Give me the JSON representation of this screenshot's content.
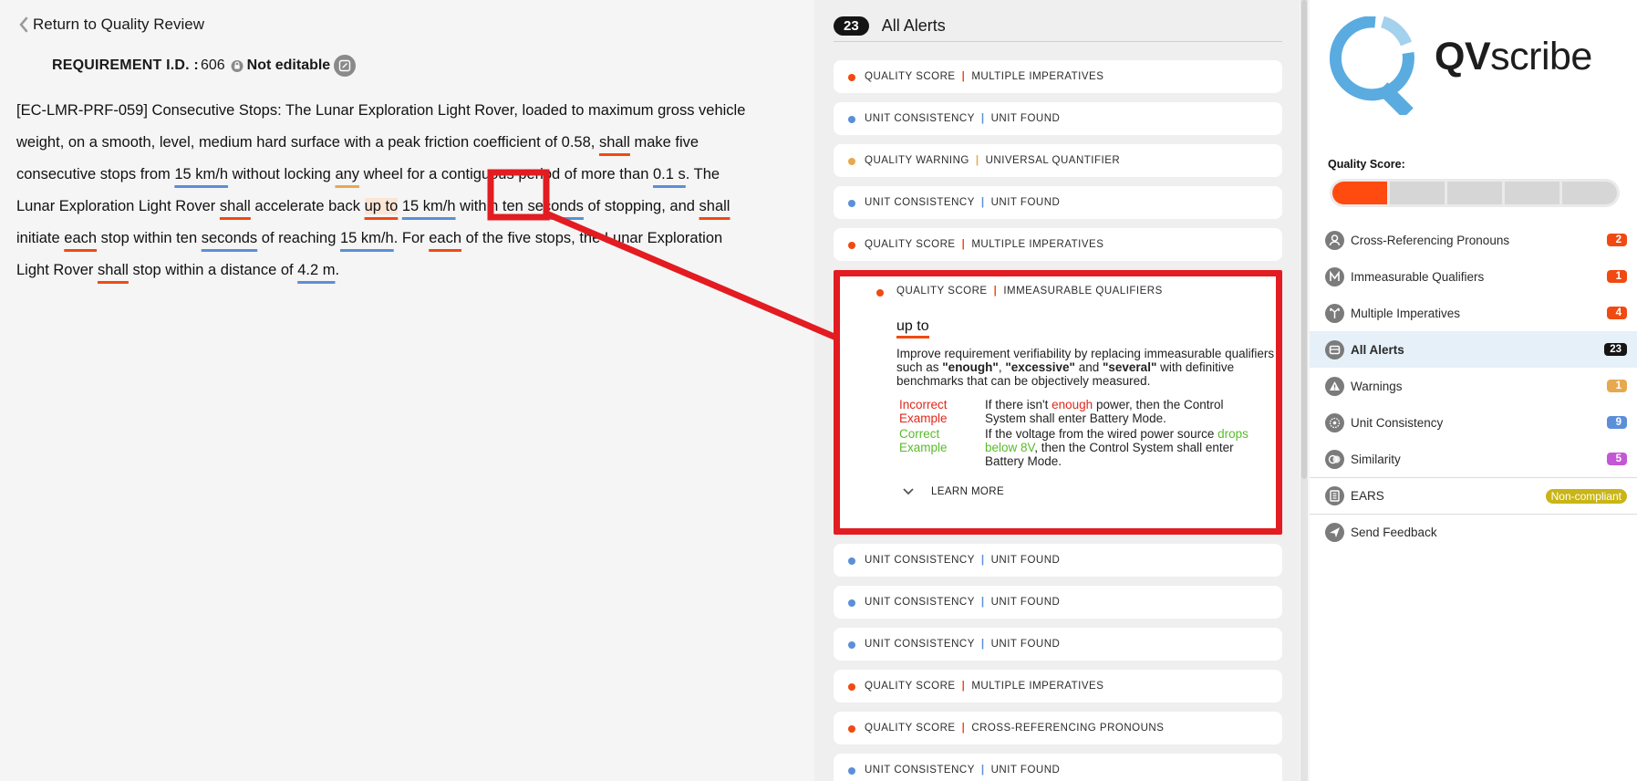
{
  "back": {
    "label": "Return to Quality Review"
  },
  "requirement": {
    "id_label": "REQUIREMENT I.D. :",
    "id_value": "606",
    "lock_text": "Not editable",
    "segments": [
      {
        "t": "[EC-LMR-PRF-059] Consecutive Stops: The Lunar Exploration Light Rover, loaded to maximum gross vehicle weight, on a smooth, level, medium hard surface with a peak friction coefficient of 0.58, "
      },
      {
        "t": "shall",
        "c": "red"
      },
      {
        "t": " make five consecutive stops from "
      },
      {
        "t": "15 km/h",
        "c": "blue"
      },
      {
        "t": " without locking "
      },
      {
        "t": "any",
        "c": "amber"
      },
      {
        "t": " wheel for a contiguous period of more than "
      },
      {
        "t": "0.1 s",
        "c": "blue"
      },
      {
        "t": ". The Lunar Exploration Light Rover "
      },
      {
        "t": "shall",
        "c": "red"
      },
      {
        "t": " accelerate back "
      },
      {
        "t": "up to",
        "c": "red sel"
      },
      {
        "t": " "
      },
      {
        "t": "15 km/h",
        "c": "blue"
      },
      {
        "t": " within ten "
      },
      {
        "t": "seconds",
        "c": "blue"
      },
      {
        "t": " of stopping, and "
      },
      {
        "t": "shall",
        "c": "red"
      },
      {
        "t": " initiate "
      },
      {
        "t": "each",
        "c": "red"
      },
      {
        "t": " stop within ten "
      },
      {
        "t": "seconds",
        "c": "blue"
      },
      {
        "t": " of reaching "
      },
      {
        "t": "15 km/h",
        "c": "blue"
      },
      {
        "t": ". For "
      },
      {
        "t": "each",
        "c": "red"
      },
      {
        "t": " of the five stops, the Lunar Exploration Light Rover "
      },
      {
        "t": "shall",
        "c": "red"
      },
      {
        "t": " stop within a distance of "
      },
      {
        "t": "4.2 m",
        "c": "blue"
      },
      {
        "t": "."
      }
    ]
  },
  "alerts_panel": {
    "count": "23",
    "title": "All Alerts",
    "separator": "|",
    "items": [
      {
        "cat": "QUALITY SCORE",
        "type": "MULTIPLE IMPERATIVES",
        "color": "#f04a12"
      },
      {
        "cat": "UNIT CONSISTENCY",
        "type": "UNIT FOUND",
        "color": "#5b8fd8"
      },
      {
        "cat": "QUALITY WARNING",
        "type": "UNIVERSAL QUANTIFIER",
        "color": "#e7a94f"
      },
      {
        "cat": "UNIT CONSISTENCY",
        "type": "UNIT FOUND",
        "color": "#5b8fd8"
      },
      {
        "cat": "QUALITY SCORE",
        "type": "MULTIPLE IMPERATIVES",
        "color": "#f04a12"
      },
      {
        "cat": "QUALITY SCORE",
        "type": "IMMEASURABLE QUALIFIERS",
        "color": "#f04a12",
        "expanded": true
      },
      {
        "cat": "UNIT CONSISTENCY",
        "type": "UNIT FOUND",
        "color": "#5b8fd8"
      },
      {
        "cat": "UNIT CONSISTENCY",
        "type": "UNIT FOUND",
        "color": "#5b8fd8"
      },
      {
        "cat": "UNIT CONSISTENCY",
        "type": "UNIT FOUND",
        "color": "#5b8fd8"
      },
      {
        "cat": "QUALITY SCORE",
        "type": "MULTIPLE IMPERATIVES",
        "color": "#f04a12"
      },
      {
        "cat": "QUALITY SCORE",
        "type": "CROSS-REFERENCING PRONOUNS",
        "color": "#f04a12"
      },
      {
        "cat": "UNIT CONSISTENCY",
        "type": "UNIT FOUND",
        "color": "#5b8fd8"
      }
    ],
    "expanded": {
      "word": "up to",
      "desc_1": "Improve requirement verifiability by replacing immeasurable qualifiers such as ",
      "q1": "\"enough\"",
      "comma": ", ",
      "q2": "\"excessive\"",
      "and": " and ",
      "q3": "\"several\"",
      "desc_2": " with definitive benchmarks that can be objectively measured.",
      "incorrect_label": "Incorrect Example",
      "incorrect_pre": "If there isn't ",
      "incorrect_hl": "enough",
      "incorrect_post": " power, then the Control System shall enter Battery Mode.",
      "correct_label": "Correct Example",
      "correct_pre": "If the voltage from the wired power source ",
      "correct_hl": "drops below 8V",
      "correct_post": ", then the Control System shall enter Battery Mode.",
      "learn_more": "LEARN MORE"
    }
  },
  "sidebar": {
    "brand_bold": "QV",
    "brand_rest": "scribe",
    "brand_color": "#5aace0",
    "quality_score_label": "Quality Score:",
    "quality_score": 1,
    "quality_score_max": 5,
    "nav": [
      {
        "label": "Cross-Referencing Pronouns",
        "badge": "2",
        "color": "#f04a12",
        "icon": "pronoun-icon"
      },
      {
        "label": "Immeasurable Qualifiers",
        "badge": "1",
        "color": "#f04a12",
        "icon": "qualifier-icon"
      },
      {
        "label": "Multiple Imperatives",
        "badge": "4",
        "color": "#f04a12",
        "icon": "imperatives-icon"
      },
      {
        "label": "All Alerts",
        "badge": "23",
        "color": "#151515",
        "icon": "inbox-icon",
        "active": true
      },
      {
        "label": "Warnings",
        "badge": "1",
        "color": "#e7a94f",
        "icon": "warning-icon"
      },
      {
        "label": "Unit Consistency",
        "badge": "9",
        "color": "#5b8fd8",
        "icon": "unit-icon"
      },
      {
        "label": "Similarity",
        "badge": "5",
        "color": "#c357d6",
        "icon": "similarity-icon"
      },
      {
        "label": "EARS",
        "badge": "Non-compliant",
        "color": "#c9b516",
        "icon": "ears-icon",
        "divider": true,
        "wide": true
      },
      {
        "label": "Send Feedback",
        "icon": "send-icon",
        "divider": true
      }
    ]
  }
}
